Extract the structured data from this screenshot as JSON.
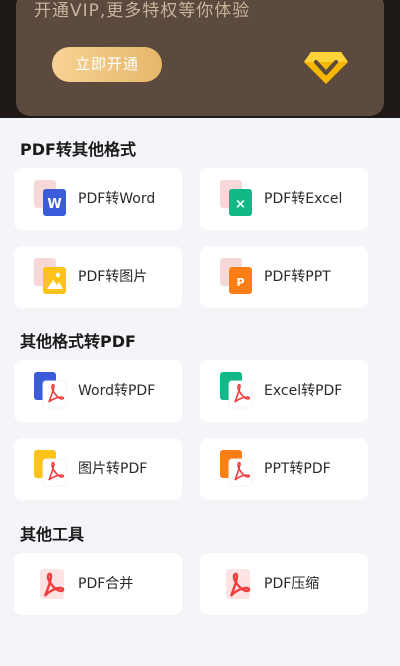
{
  "vip": {
    "subtitle": "开通VIP,更多特权等你体验",
    "button_label": "立即开通",
    "badge_icon": "diamond-icon"
  },
  "sections": [
    {
      "title": "PDF转其他格式",
      "items": [
        {
          "label": "PDF转Word",
          "icon": "word-doc-icon",
          "color": "#3b5bdb"
        },
        {
          "label": "PDF转Excel",
          "icon": "excel-doc-icon",
          "color": "#12b886"
        },
        {
          "label": "PDF转图片",
          "icon": "image-doc-icon",
          "color": "#fcc419"
        },
        {
          "label": "PDF转PPT",
          "icon": "ppt-doc-icon",
          "color": "#fd7e14"
        }
      ]
    },
    {
      "title": "其他格式转PDF",
      "items": [
        {
          "label": "Word转PDF",
          "icon": "word-to-pdf-icon",
          "color": "#3b5bdb"
        },
        {
          "label": "Excel转PDF",
          "icon": "excel-to-pdf-icon",
          "color": "#12b886"
        },
        {
          "label": "图片转PDF",
          "icon": "image-to-pdf-icon",
          "color": "#fcc419"
        },
        {
          "label": "PPT转PDF",
          "icon": "ppt-to-pdf-icon",
          "color": "#fd7e14"
        }
      ]
    },
    {
      "title": "其他工具",
      "items": [
        {
          "label": "PDF合并",
          "icon": "pdf-merge-icon",
          "color": "#f03e3e"
        },
        {
          "label": "PDF压缩",
          "icon": "pdf-compress-icon",
          "color": "#f03e3e"
        }
      ]
    }
  ],
  "colors": {
    "pdf_red": "#f03e3e",
    "vip_gold": "#f7d294",
    "vip_brown": "#5c4a3e"
  }
}
